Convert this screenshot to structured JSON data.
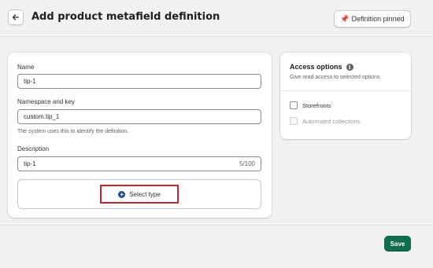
{
  "header": {
    "back_icon": "arrow-left-icon",
    "title": "Add product metafield definition",
    "pin_button_label": "Definition pinned",
    "pin_icon": "pin-icon"
  },
  "form": {
    "name_label": "Name",
    "name_value": "tip-1",
    "namespace_label": "Namespace and key",
    "namespace_value": "custom.tip_1",
    "namespace_help": "The system uses this to identify the definition.",
    "description_label": "Description",
    "description_value": "tip-1",
    "description_counter": "5/100",
    "select_type_label": "Select type",
    "select_type_icon": "plus-circle-icon"
  },
  "access": {
    "title": "Access options",
    "info_icon": "info-icon",
    "subtitle": "Give read access to selected options.",
    "options": [
      {
        "label": "Storefronts",
        "checked": false,
        "disabled": false
      },
      {
        "label": "Automated collections",
        "checked": false,
        "disabled": true
      }
    ]
  },
  "footer": {
    "save_label": "Save"
  },
  "colors": {
    "primary": "#0f6e4b",
    "highlight": "#c0262d",
    "background": "#f1f1f1"
  }
}
